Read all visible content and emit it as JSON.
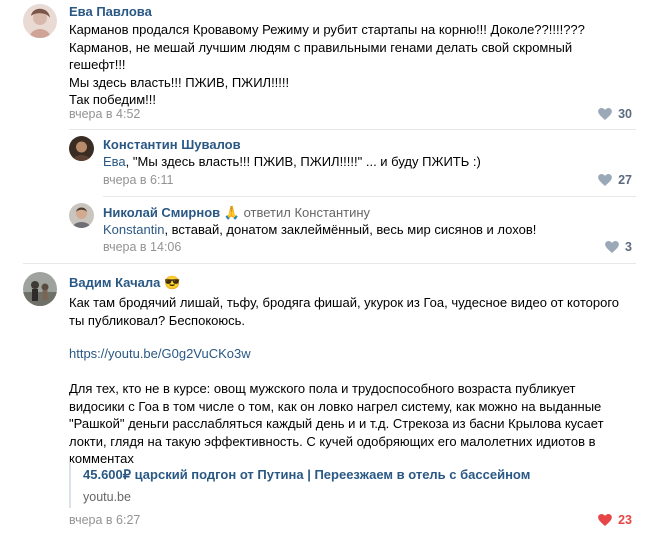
{
  "comments": [
    {
      "author": "Ева Павлова",
      "lines": [
        "Карманов продался Кровавому Режиму и рубит стартапы на корню!!! Доколе??!!!!???",
        "Карманов, не мешай лучшим людям с правильными генами делать свой скромный",
        "гешефт!!!",
        "Мы здесь власть!!! ПЖИВ, ПЖИЛ!!!!!",
        "Так победим!!!"
      ],
      "time": "вчера в 4:52",
      "likes": "30"
    },
    {
      "author": "Константин Шувалов",
      "mention": "Ева",
      "text": ", \"Мы здесь власть!!! ПЖИВ, ПЖИЛ!!!!!\" ... и буду ПЖИТЬ :)",
      "time": "вчера в 6:11",
      "likes": "27"
    },
    {
      "author": "Николай Смирнов",
      "author_emoji": "🙏",
      "replied": "ответил Константину",
      "mention": "Konstantin",
      "text": ", вставай, донатом заклеймённый, весь мир сисянов и лохов!",
      "time": "вчера в 14:06",
      "likes": "3"
    },
    {
      "author": "Вадим Качала",
      "author_emoji": "😎",
      "lines": [
        "Как там бродячий лишай, тьфу, бродяга фишай, укурок из Гоа, чудесное видео от которого",
        "ты публиковал? Беспокоюсь."
      ],
      "link": "https://youtu.be/G0g2VuCKo3w",
      "para_lines": [
        "Для тех, кто не в курсе: овощ мужского пола и трудоспособного возраста публикует",
        "видосики с Гоа в том числе о том, как он ловко нагрел систему, как можно на выданные",
        "\"Рашкой\" деньги расслабляться каждый день и и т.д. Стрекоза из басни Крылова кусает",
        "локти, глядя на такую эффективность. С кучей одобряющих его малолетних идиотов в",
        "комментах"
      ],
      "snippet_title": "45.600₽ царский подгон от Путина | Переезжаем в отель с бассейном",
      "snippet_domain": "youtu.be",
      "time": "вчера в 6:27",
      "likes": "23"
    }
  ],
  "colors": {
    "link": "#2a5885",
    "meta": "#939393",
    "like_active": "#e64646",
    "like_idle": "#5c6b7d",
    "separator": "#e7e8ec"
  },
  "icons": {
    "like": "heart-icon"
  }
}
